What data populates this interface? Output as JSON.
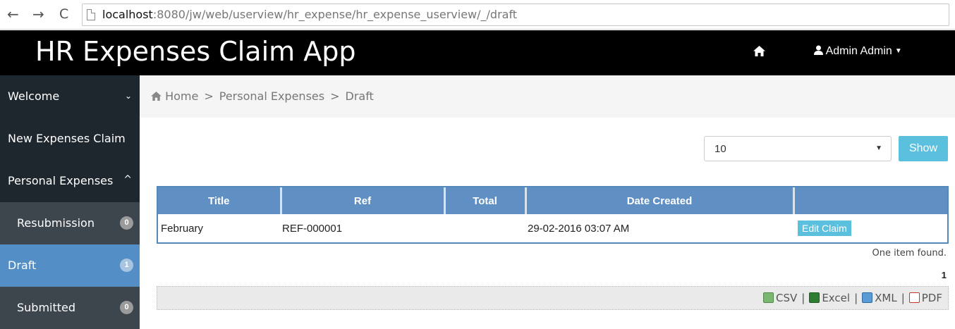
{
  "browser": {
    "back_icon": "←",
    "forward_icon": "→",
    "reload_icon": "C",
    "url_host": "localhost",
    "url_rest": ":8080/jw/web/userview/hr_expense/hr_expense_userview/_/draft"
  },
  "header": {
    "title": "HR Expenses Claim App",
    "home_icon": "home-icon",
    "user_name": "Admin Admin"
  },
  "sidebar": {
    "items": [
      {
        "label": "Welcome",
        "chevron": "⌄"
      },
      {
        "label": "New Expenses Claim"
      },
      {
        "label": "Personal Expenses",
        "chevron": "^"
      },
      {
        "label": "Resubmission",
        "badge": "0"
      },
      {
        "label": "Draft",
        "badge": "1",
        "active": true
      },
      {
        "label": "Submitted",
        "badge": "0"
      }
    ]
  },
  "breadcrumb": {
    "items": [
      "Home",
      "Personal Expenses",
      "Draft"
    ],
    "separator": ">"
  },
  "filter": {
    "page_size": "10",
    "show_label": "Show"
  },
  "table": {
    "columns": [
      "Title",
      "Ref",
      "Total",
      "Date Created",
      ""
    ],
    "rows": [
      {
        "title": "February",
        "ref": "REF-000001",
        "total": "",
        "date_created": "29-02-2016 03:07 AM",
        "action": "Edit Claim"
      }
    ]
  },
  "footer": {
    "items_found": "One item found.",
    "page_number": "1",
    "exports": [
      "CSV",
      "Excel",
      "XML",
      "PDF"
    ]
  },
  "colors": {
    "header_bg": "#000000",
    "sidebar_bg": "#333b42",
    "active_item": "#548ec6",
    "table_header": "#5f8fc3",
    "button": "#5bc0de"
  }
}
